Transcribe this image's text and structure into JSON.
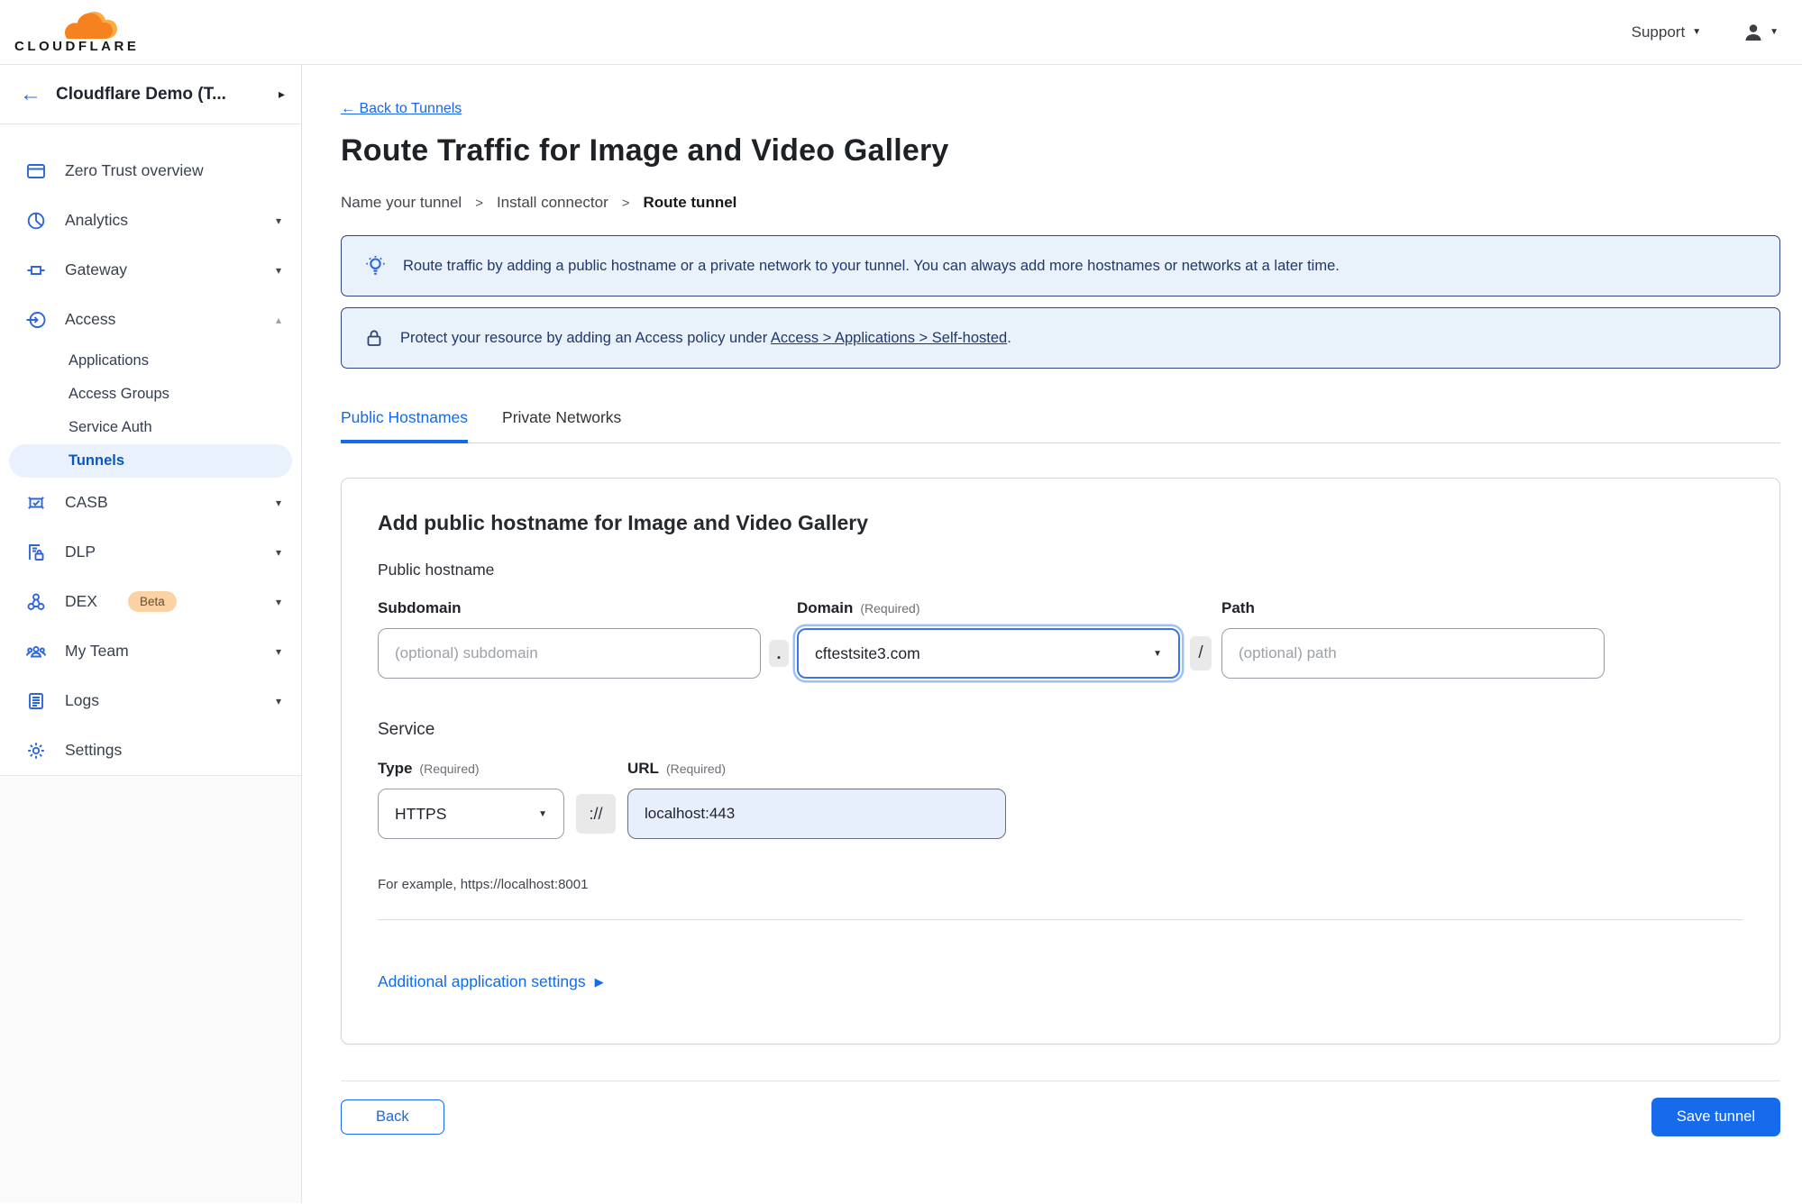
{
  "colors": {
    "accent_blue": "#156bec",
    "link_blue": "#1a66e8",
    "banner_bg": "#e9f1fb",
    "banner_border": "#2b477e",
    "banner_text": "#20386a",
    "active_pill_bg": "#e8f1fc",
    "active_pill_text": "#0a57c2",
    "beta_badge_bg": "#fad2a3",
    "logo_orange": "#f6821f",
    "logo_light_orange": "#fbad41",
    "url_field_bg": "#e7effd"
  },
  "topbar": {
    "logo_text": "CLOUDFLARE",
    "support_label": "Support",
    "support_caret": "▼",
    "user_caret": "▼"
  },
  "sidebar": {
    "account_back": "←",
    "account_label": "Cloudflare Demo (T...",
    "account_expand": "▸",
    "nav": [
      {
        "label": "Zero Trust overview",
        "icon": "window-icon",
        "caret": ""
      },
      {
        "label": "Analytics",
        "icon": "analytics-icon",
        "caret": "▾"
      },
      {
        "label": "Gateway",
        "icon": "gateway-icon",
        "caret": "▾"
      },
      {
        "label": "Access",
        "icon": "access-icon",
        "caret": "▴",
        "expanded": true
      },
      {
        "label": "CASB",
        "icon": "casb-icon",
        "caret": "▾"
      },
      {
        "label": "DLP",
        "icon": "dlp-icon",
        "caret": "▾"
      },
      {
        "label": "DEX",
        "icon": "dex-icon",
        "caret": "▾",
        "badge": "Beta"
      },
      {
        "label": "My Team",
        "icon": "team-icon",
        "caret": "▾"
      },
      {
        "label": "Logs",
        "icon": "logs-icon",
        "caret": "▾"
      },
      {
        "label": "Settings",
        "icon": "gear-icon",
        "caret": ""
      }
    ],
    "access_children": [
      {
        "label": "Applications",
        "active": false
      },
      {
        "label": "Access Groups",
        "active": false
      },
      {
        "label": "Service Auth",
        "active": false
      },
      {
        "label": "Tunnels",
        "active": true
      }
    ]
  },
  "main": {
    "back_link": "← Back to Tunnels",
    "title": "Route Traffic for Image and Video Gallery",
    "steps": {
      "s1": "Name your tunnel",
      "s2": "Install connector",
      "s3": "Route tunnel",
      "sep": ">"
    },
    "banners": {
      "tip_text": "Route traffic by adding a public hostname or a private network to your tunnel. You can always add more hostnames or networks at a later time.",
      "protect_prefix": "Protect your resource by adding an Access policy under ",
      "protect_link": "Access > Applications > Self-hosted",
      "protect_suffix": "."
    },
    "tabs": {
      "public": "Public Hostnames",
      "private": "Private Networks"
    },
    "card": {
      "title": "Add public hostname for Image and Video Gallery",
      "public_hostname_label": "Public hostname",
      "subdomain_label": "Subdomain",
      "domain_label": "Domain",
      "path_label": "Path",
      "required_note": "(Required)",
      "subdomain_placeholder": "(optional) subdomain",
      "domain_value": "cftestsite3.com",
      "path_placeholder": "(optional) path",
      "dot_separator": ".",
      "slash_separator": "/",
      "service_label": "Service",
      "type_label": "Type",
      "type_value": "HTTPS",
      "scheme_separator": "://",
      "url_label": "URL",
      "url_value": "localhost:443",
      "example_text": "For example, https://localhost:8001",
      "additional_settings_label": "Additional application settings",
      "additional_settings_arrow": "▶",
      "select_caret": "▼"
    },
    "footer": {
      "back_label": "Back",
      "save_label": "Save tunnel"
    }
  }
}
